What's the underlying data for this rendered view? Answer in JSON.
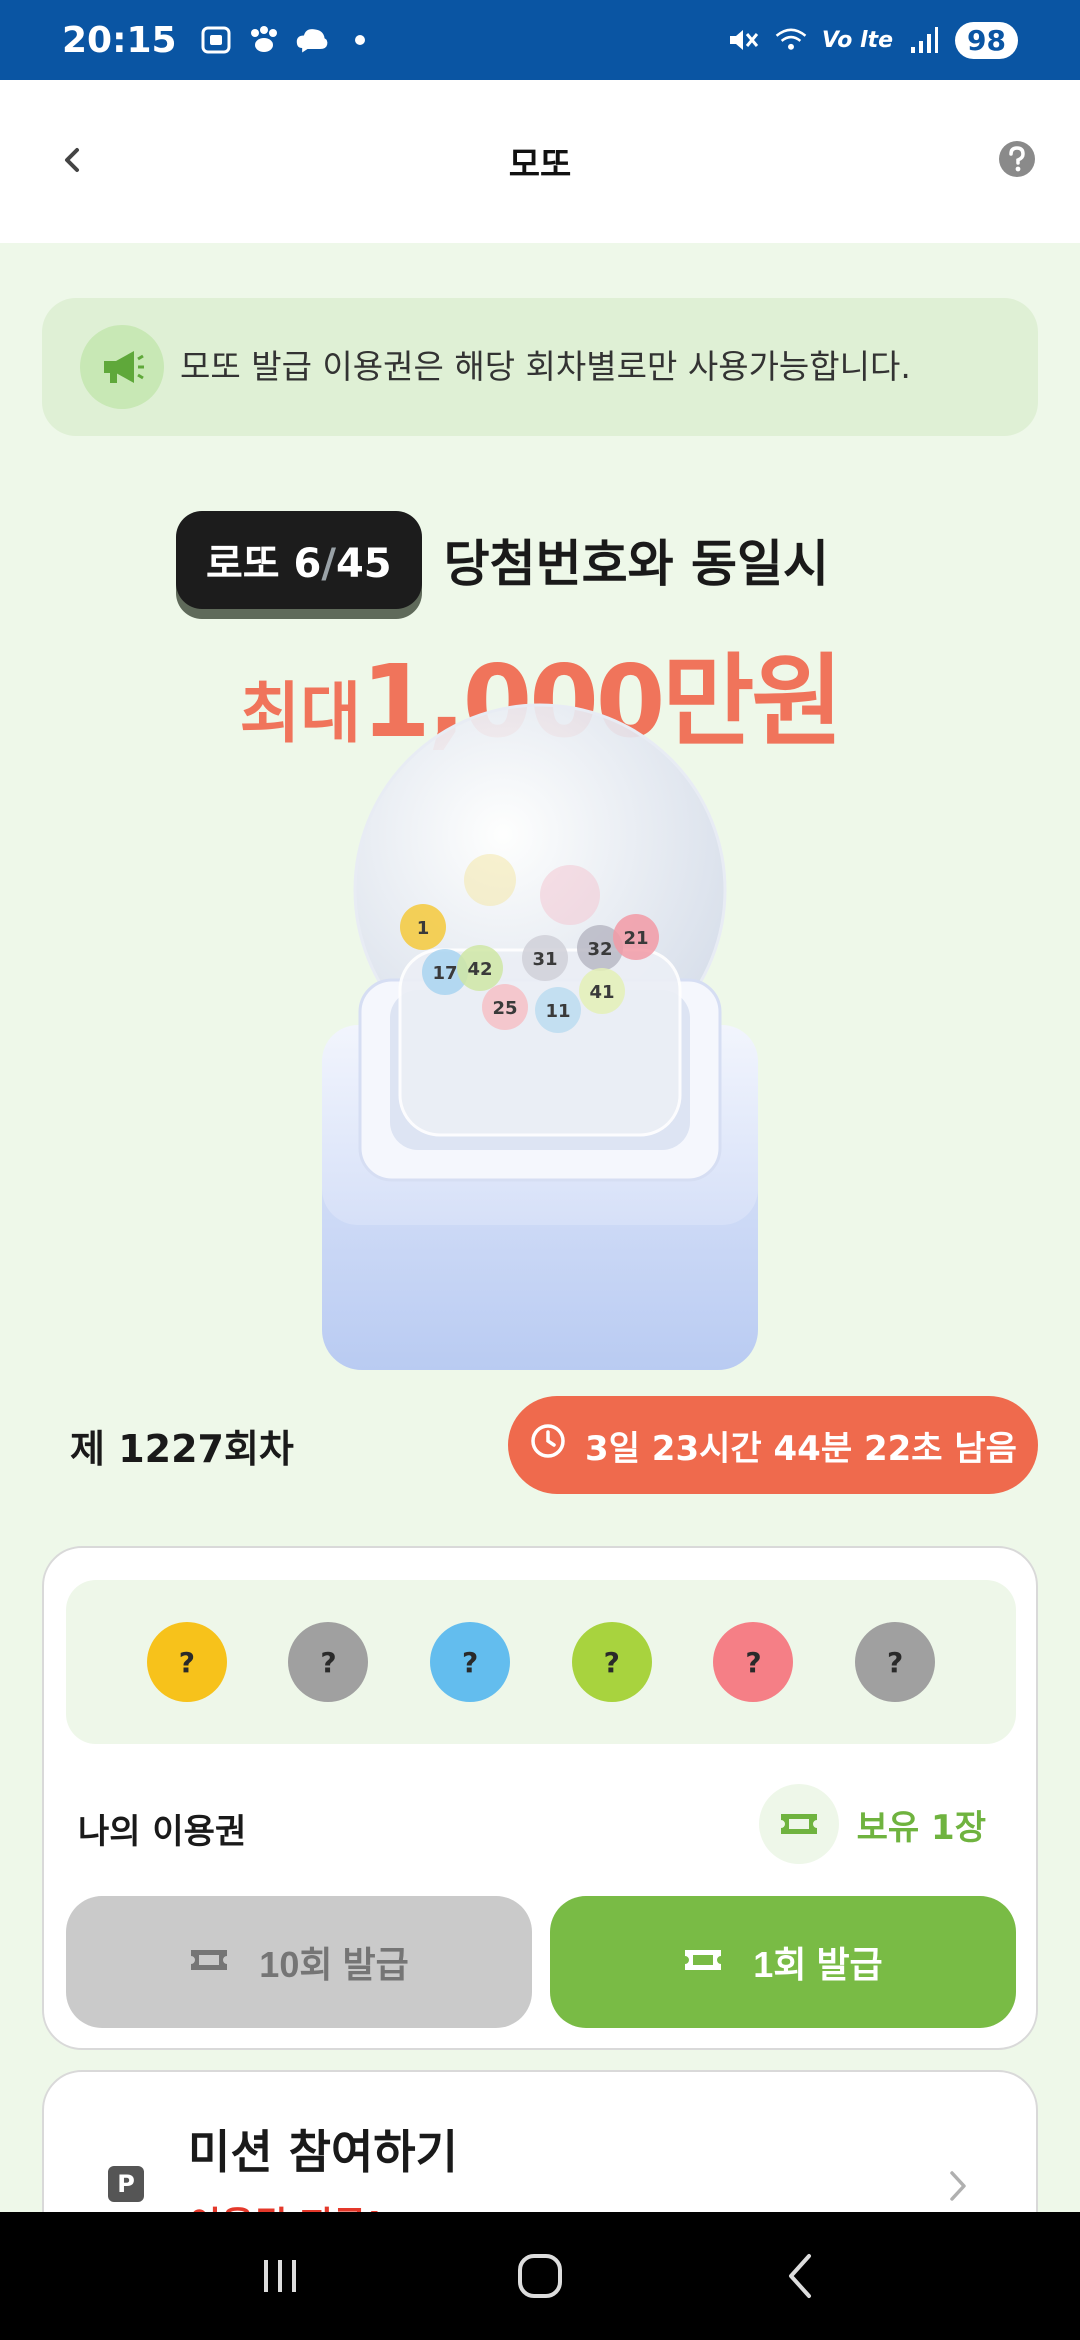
{
  "status_bar": {
    "time": "20:15",
    "left_icons": [
      "screenshot-icon",
      "paw-icon",
      "cloud-chat-icon",
      "dot-icon"
    ],
    "right_icons": [
      "mute-icon",
      "wifi-icon",
      "volte-icon",
      "signal-icon"
    ],
    "volte_text": "Vo lte",
    "battery": "98"
  },
  "header": {
    "title": "모또",
    "back_icon": "chevron-left-icon",
    "help_icon": "question-circle-icon"
  },
  "notice": {
    "icon": "megaphone-icon",
    "text": "모또 발급 이용권은 해당 회차별로만 사용가능합니다."
  },
  "hero": {
    "badge_prefix": "로또 6",
    "badge_slash": "/",
    "badge_suffix": "45",
    "headline": "당첨번호와 동일시",
    "prize_small": "최대",
    "prize_big": "1,000만원"
  },
  "machine": {
    "balls": [
      {
        "num": "1",
        "color": "#f4c93b"
      },
      {
        "num": "17",
        "color": "#a9d4f0"
      },
      {
        "num": "42",
        "color": "#cfe6a4"
      },
      {
        "num": "31",
        "color": "#d0d0d8"
      },
      {
        "num": "32",
        "color": "#b8b8c4"
      },
      {
        "num": "21",
        "color": "#f29aa6"
      },
      {
        "num": "25",
        "color": "#f6c0c6"
      },
      {
        "num": "11",
        "color": "#bcdcf0"
      },
      {
        "num": "41",
        "color": "#e4f0b6"
      }
    ]
  },
  "round": {
    "label": "제 1227회차",
    "timer_icon": "clock-icon",
    "timer_text": "3일 23시간 44분 22초 남음"
  },
  "draw": {
    "balls": [
      {
        "label": "?",
        "color": "#f7c21b"
      },
      {
        "label": "?",
        "color": "#a0a0a0"
      },
      {
        "label": "?",
        "color": "#63bdee"
      },
      {
        "label": "?",
        "color": "#a8d33e"
      },
      {
        "label": "?",
        "color": "#f57f86"
      },
      {
        "label": "?",
        "color": "#a0a0a0"
      }
    ],
    "ticket_label": "나의 이용권",
    "hold_text": "보유 1장",
    "ticket_icon": "ticket-icon",
    "btn_ten": "10회 발급",
    "btn_one": "1회 발급"
  },
  "mission": {
    "icon_text": "P",
    "title": "미션 참여하기",
    "subtitle": "이용권 지급!",
    "chevron": "chevron-right-icon"
  },
  "nav": {
    "recent": "recent-apps-icon",
    "home": "home-icon",
    "back": "back-icon"
  },
  "colors": {
    "accent_green": "#79bb45",
    "accent_orange": "#ef6a4d",
    "status_blue": "#0a55a3",
    "bg_green": "#eef8e9"
  }
}
